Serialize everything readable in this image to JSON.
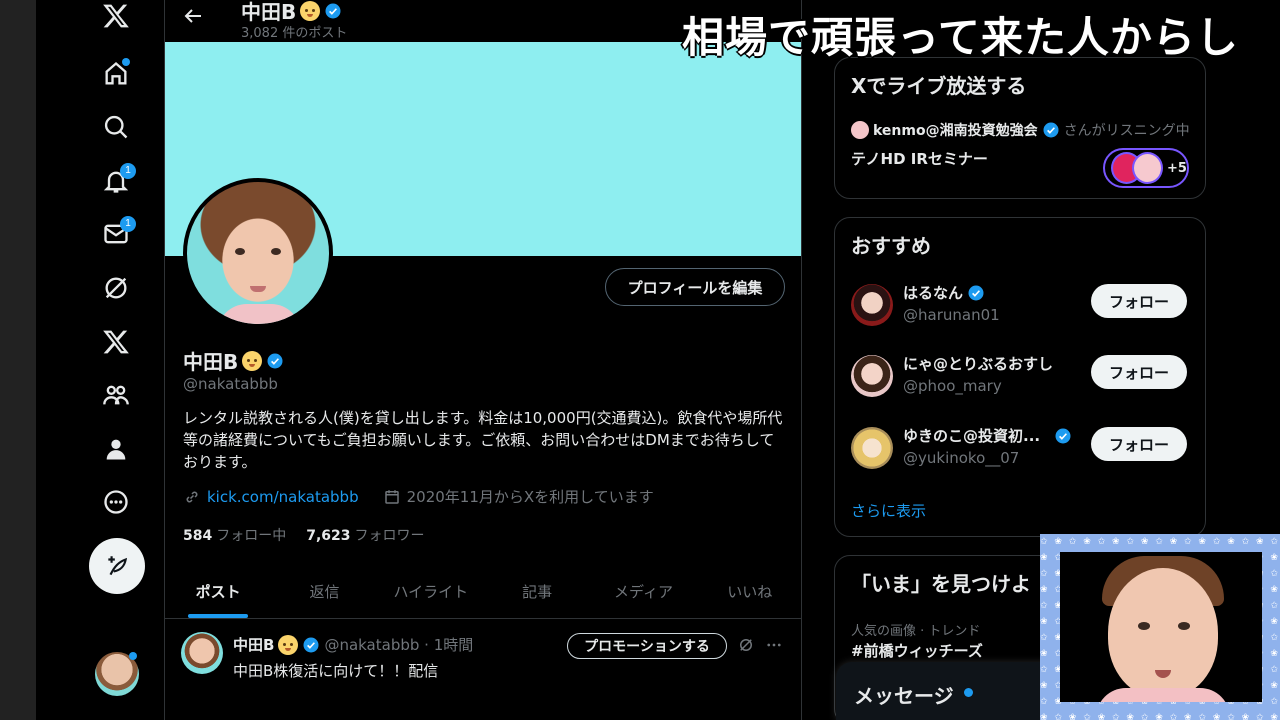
{
  "overlay_title": "相場で頑張って来た人からし",
  "topbar": {
    "name": "中田B",
    "post_count": "3,082 件のポスト"
  },
  "nav": {
    "notifications_badge": "1",
    "messages_badge": "1"
  },
  "profile": {
    "edit_button": "プロフィールを編集",
    "name": "中田B",
    "handle": "@nakatabbb",
    "bio": "レンタル説教される人(僕)を貸し出します。料金は10,000円(交通費込)。飲食代や場所代等の諸経費についてもご負担お願いします。ご依頼、お問い合わせはDMまでお待ちしております。",
    "link": "kick.com/nakatabbb",
    "joined": "2020年11月からXを利用しています",
    "following_count": "584",
    "following_label": "フォロー中",
    "followers_count": "7,623",
    "followers_label": "フォロワー"
  },
  "tabs": [
    {
      "label": "ポスト"
    },
    {
      "label": "返信"
    },
    {
      "label": "ハイライト"
    },
    {
      "label": "記事"
    },
    {
      "label": "メディア"
    },
    {
      "label": "いいね"
    }
  ],
  "post": {
    "name": "中田B",
    "handle_time": "@nakatabbb · 1時間",
    "promote_button": "プロモーションする",
    "text": "中田B株復活に向けて！！配信"
  },
  "live": {
    "title": "Xでライブ放送する",
    "listener_name": "kenmo@湘南投資勉強会",
    "listener_suffix": "さんがリスニング中",
    "space_title": "テノHD IRセミナー",
    "extra_count": "+5"
  },
  "recommend": {
    "title": "おすすめ",
    "follow_label": "フォロー",
    "users": [
      {
        "name": "はるなん",
        "handle": "@harunan01",
        "verified": true
      },
      {
        "name": "にゃ@とりぶるおすし",
        "handle": "@phoo_mary",
        "verified": false
      },
      {
        "name": "ゆきのこ@投資初...",
        "handle": "@yukinoko__07",
        "verified": true
      }
    ],
    "more": "さらに表示"
  },
  "trend": {
    "title": "「いま」を見つけよ",
    "context": "人気の画像 · トレンド",
    "tag": "#前橋ウィッチーズ"
  },
  "messages": {
    "label": "メッセージ"
  },
  "colors": {
    "accent": "#1d9bf0",
    "banner": "#8eeef0",
    "background": "#000000"
  }
}
